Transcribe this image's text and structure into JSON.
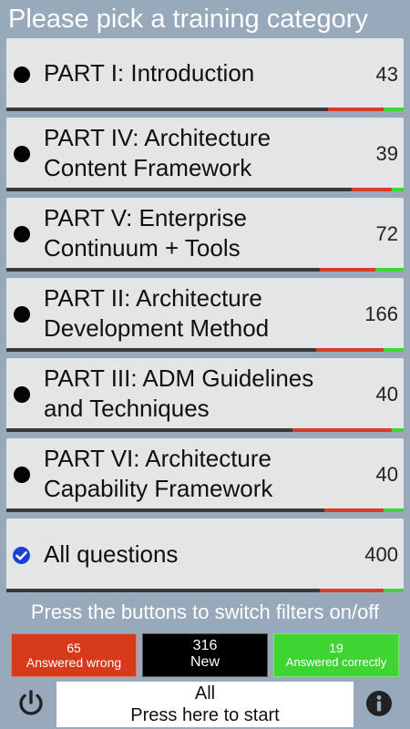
{
  "header": {
    "title": "Please pick a training category"
  },
  "categories": [
    {
      "label": "PART I: Introduction",
      "count": "43",
      "wrong_fraction": 0.14,
      "correct_fraction": 0.05
    },
    {
      "label": "PART IV: Architecture Content Framework",
      "count": "39",
      "wrong_fraction": 0.1,
      "correct_fraction": 0.03
    },
    {
      "label": "PART V: Enterprise Continuum + Tools",
      "count": "72",
      "wrong_fraction": 0.14,
      "correct_fraction": 0.07
    },
    {
      "label": "PART II: Architecture Development Method",
      "count": "166",
      "wrong_fraction": 0.17,
      "correct_fraction": 0.05
    },
    {
      "label": "PART III: ADM Guidelines and Techniques",
      "count": "40",
      "wrong_fraction": 0.25,
      "correct_fraction": 0.03
    },
    {
      "label": "PART VI: Architecture Capability Framework",
      "count": "40",
      "wrong_fraction": 0.15,
      "correct_fraction": 0.05
    },
    {
      "label": "All questions",
      "count": "400",
      "wrong_fraction": 0.16,
      "correct_fraction": 0.05,
      "selected": true
    }
  ],
  "hint": "Press the buttons to switch filters on/off",
  "filters": {
    "wrong": {
      "count": "65",
      "label": "Answered wrong"
    },
    "new": {
      "count": "316",
      "label": "New"
    },
    "correct": {
      "count": "19",
      "label": "Answered correctly"
    }
  },
  "start": {
    "line1": "All",
    "line2": "Press here to start"
  },
  "icons": {
    "power": "power-icon",
    "info": "info-icon",
    "check": "check-circle-icon",
    "dot": "bullet-dot-icon"
  },
  "colors": {
    "background": "#97a9bb",
    "wrong": "#d7391b",
    "new": "#000000",
    "correct": "#3ed431",
    "check": "#1d3fd8"
  }
}
